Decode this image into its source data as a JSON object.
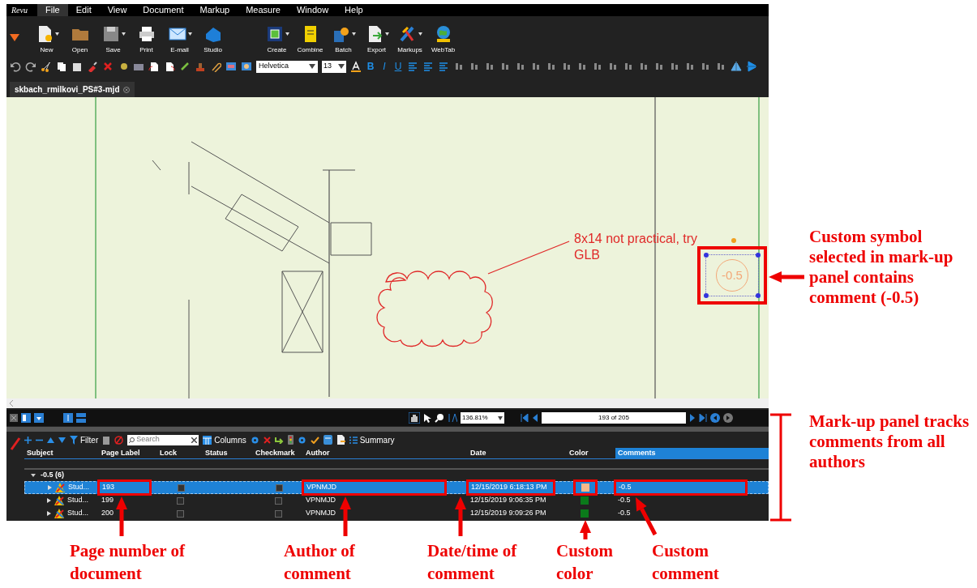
{
  "app": {
    "logo": "Revu"
  },
  "menu": [
    {
      "label": "File",
      "selected": true
    },
    {
      "label": "Edit",
      "selected": false
    },
    {
      "label": "View",
      "selected": false
    },
    {
      "label": "Document",
      "selected": false
    },
    {
      "label": "Markup",
      "selected": false
    },
    {
      "label": "Measure",
      "selected": false
    },
    {
      "label": "Window",
      "selected": false
    },
    {
      "label": "Help",
      "selected": false
    }
  ],
  "toolbar": [
    {
      "label": "New",
      "kind": "new",
      "dropdown": true
    },
    {
      "label": "Open",
      "kind": "open",
      "dropdown": false
    },
    {
      "label": "Save",
      "kind": "save",
      "dropdown": true
    },
    {
      "label": "Print",
      "kind": "print",
      "dropdown": false
    },
    {
      "label": "E-mail",
      "kind": "email",
      "dropdown": true
    },
    {
      "label": "Studio",
      "kind": "studio",
      "dropdown": false
    },
    {
      "label": "Create",
      "kind": "create",
      "dropdown": true
    },
    {
      "label": "Combine",
      "kind": "combine",
      "dropdown": false
    },
    {
      "label": "Batch",
      "kind": "batch",
      "dropdown": true
    },
    {
      "label": "Export",
      "kind": "export",
      "dropdown": true
    },
    {
      "label": "Markups",
      "kind": "markups",
      "dropdown": true
    },
    {
      "label": "WebTab",
      "kind": "webtab",
      "dropdown": false
    }
  ],
  "format_bar": {
    "font": "Helvetica",
    "size": "13",
    "bold": "B",
    "italic": "I",
    "underline": "U"
  },
  "tab": {
    "title": "skbach_rmilkovi_PS#3-mjd"
  },
  "canvas": {
    "markup_text": "8x14 not practical, try GLB",
    "symbol": {
      "text": "-0.5",
      "selected": true,
      "annotated": true
    }
  },
  "nav": {
    "zoom": "136.81%",
    "page": "193 of 205"
  },
  "panel": {
    "filter": "Filter",
    "search_placeholder": "Search",
    "columns_button": "Columns",
    "summary": "Summary",
    "columns": [
      {
        "label": "Subject",
        "selected": false
      },
      {
        "label": "Page Label",
        "selected": false
      },
      {
        "label": "Lock",
        "selected": false
      },
      {
        "label": "Status",
        "selected": false
      },
      {
        "label": "Checkmark",
        "selected": false
      },
      {
        "label": "Author",
        "selected": false
      },
      {
        "label": "Date",
        "selected": false
      },
      {
        "label": "Color",
        "selected": false
      },
      {
        "label": "Comments",
        "selected": true
      }
    ],
    "group": {
      "label": "-0.5 (6)",
      "expanded": true
    },
    "rows": [
      {
        "subject": "Stud...",
        "page": "193",
        "author": "VPNMJD",
        "date": "12/15/2019 6:18:13 PM",
        "color": "#f5b88a",
        "comments": "-0.5",
        "selected": true,
        "highlight": {
          "page": true,
          "author": true,
          "date": true,
          "color": true,
          "comments": true
        }
      },
      {
        "subject": "Stud...",
        "page": "199",
        "author": "VPNMJD",
        "date": "12/15/2019 9:06:35 PM",
        "color": "#0a7a1a",
        "comments": "-0.5",
        "selected": false
      },
      {
        "subject": "Stud...",
        "page": "200",
        "author": "VPNMJD",
        "date": "12/15/2019 9:09:26 PM",
        "color": "#0a7a1a",
        "comments": "-0.5",
        "selected": false
      }
    ]
  },
  "callouts": {
    "side": [
      {
        "text": "Custom symbol selected in mark-up panel contains comment (-0.5)"
      },
      {
        "text": "Mark-up panel tracks comments from all authors"
      }
    ],
    "bottom": [
      {
        "text": "Page number of document"
      },
      {
        "text": "Author of comment"
      },
      {
        "text": "Date/time of comment"
      },
      {
        "text": "Custom color"
      },
      {
        "text": "Custom comment"
      }
    ]
  }
}
